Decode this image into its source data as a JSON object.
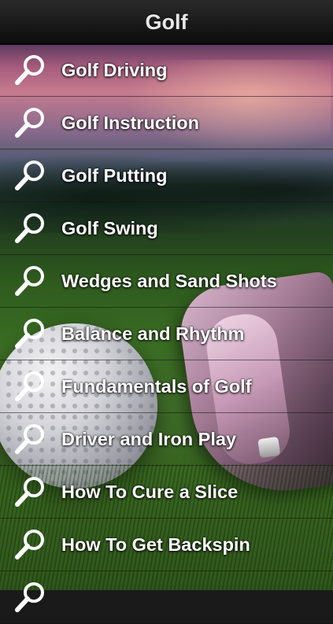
{
  "header": {
    "title": "Golf"
  },
  "menu": {
    "items": [
      {
        "label": "Golf Driving",
        "icon": "magnifier-icon"
      },
      {
        "label": "Golf Instruction",
        "icon": "magnifier-icon"
      },
      {
        "label": "Golf Putting",
        "icon": "magnifier-icon"
      },
      {
        "label": "Golf Swing",
        "icon": "magnifier-icon"
      },
      {
        "label": "Wedges and Sand Shots",
        "icon": "magnifier-icon"
      },
      {
        "label": "Balance and Rhythm",
        "icon": "magnifier-icon"
      },
      {
        "label": "Fundamentals of Golf",
        "icon": "magnifier-icon"
      },
      {
        "label": "Driver and Iron Play",
        "icon": "magnifier-icon"
      },
      {
        "label": "How To Cure a Slice",
        "icon": "magnifier-icon"
      },
      {
        "label": "How To Get Backspin",
        "icon": "magnifier-icon"
      },
      {
        "label": "",
        "icon": "magnifier-icon"
      }
    ]
  },
  "colors": {
    "header_bg": "#1a1a1a",
    "text": "#ffffff"
  }
}
